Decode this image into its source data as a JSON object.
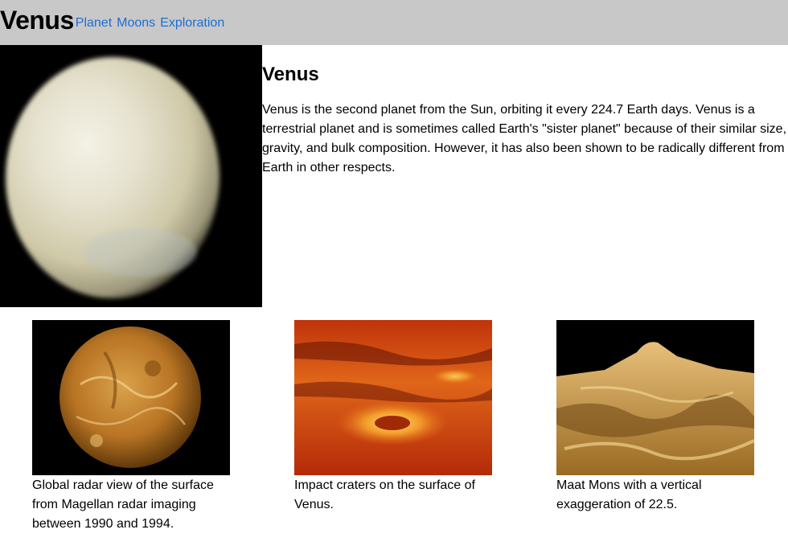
{
  "header": {
    "logo": "Venus",
    "nav": [
      "Planet",
      "Moons",
      "Exploration"
    ]
  },
  "hero": {
    "title": "Venus",
    "description": "Venus is the second planet from the Sun, orbiting it every 224.7 Earth days. Venus is a terrestrial planet and is sometimes called Earth's \"sister planet\" because of their similar size, gravity, and bulk composition. However, it has also been shown to be radically different from Earth in other respects."
  },
  "gallery": [
    {
      "caption": "Global radar view of the surface from Magellan radar imaging between 1990 and 1994."
    },
    {
      "caption": "Impact craters on the surface of Venus."
    },
    {
      "caption": "Maat Mons with a vertical exaggeration of 22.5."
    }
  ],
  "colors": {
    "header_bg": "#c8c8c8",
    "link": "#1a6ed8"
  }
}
